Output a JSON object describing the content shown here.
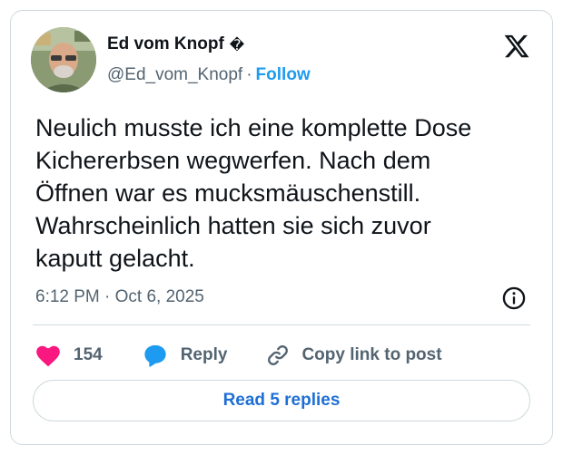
{
  "author": {
    "display_name": "Ed vom Knopf",
    "verified_glyph": "�",
    "handle": "@Ed_vom_Knopf",
    "separator": "·",
    "follow_label": "Follow"
  },
  "tweet": {
    "text": "Neulich musste ich eine komplette Dose\nKichererbsen wegwerfen. Nach dem\nÖffnen war es mucksmäuschenstill.\nWahrscheinlich hatten sie sich zuvor\nkaputt gelacht.",
    "timestamp": "6:12 PM · Oct 6, 2025"
  },
  "actions": {
    "like_count": "154",
    "reply_label": "Reply",
    "copy_label": "Copy link to post"
  },
  "read_replies_label": "Read 5 replies",
  "colors": {
    "accent": "#1d9bf0",
    "like": "#f91880",
    "text": "#0f1419",
    "muted": "#536471",
    "border": "#cfd9de"
  },
  "icons": [
    "x-logo-icon",
    "info-icon",
    "heart-icon",
    "reply-bubble-icon",
    "link-icon"
  ]
}
